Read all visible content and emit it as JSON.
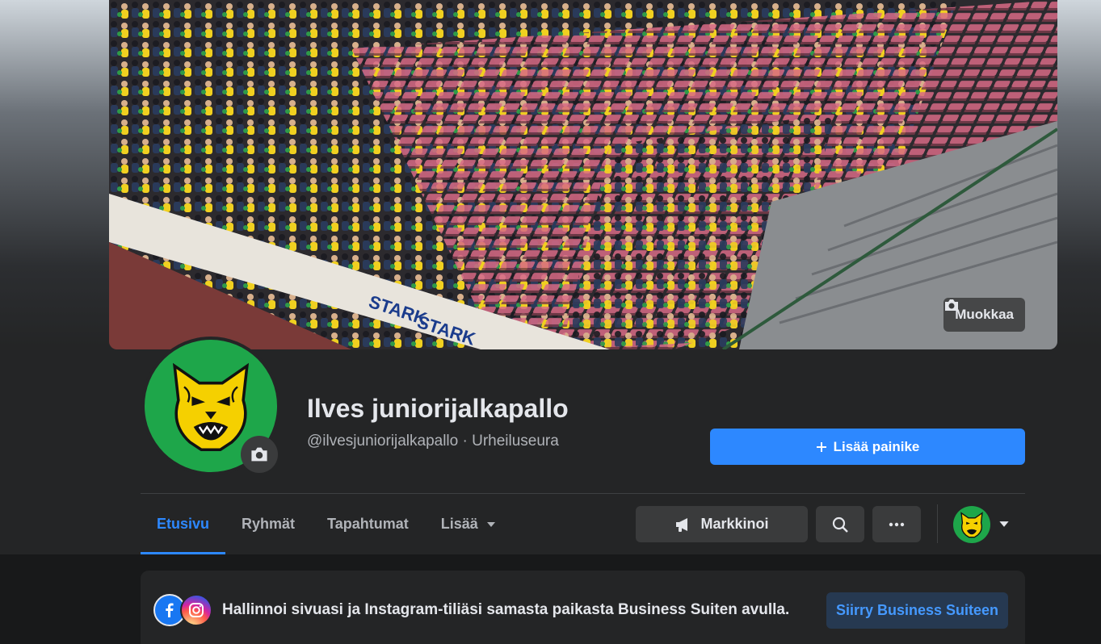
{
  "cover": {
    "edit_label": "Muokkaa"
  },
  "profile": {
    "name": "Ilves juniorijalkapallo",
    "subtitle": "@ilvesjuniorijalkapallo · Urheiluseura"
  },
  "actions": {
    "add_button_label": "Lisää painike",
    "promote_label": "Markkinoi"
  },
  "tabs": [
    {
      "label": "Etusivu",
      "active": true
    },
    {
      "label": "Ryhmät",
      "active": false
    },
    {
      "label": "Tapahtumat",
      "active": false
    },
    {
      "label": "Lisää",
      "active": false
    }
  ],
  "banner": {
    "text": "Hallinnoi sivuasi ja Instagram-tiliäsi samasta paikasta Business Suiten avulla.",
    "button_label": "Siirry Business Suiteen"
  },
  "icons": {
    "camera": "camera-icon",
    "plus": "plus-icon",
    "megaphone": "megaphone-icon",
    "search": "search-icon",
    "more": "more-icon",
    "dropdown": "caret-down-icon",
    "facebook": "facebook-icon",
    "instagram": "instagram-icon"
  },
  "colors": {
    "accent": "#2d88ff",
    "background": "#18191a",
    "surface": "#242526",
    "button": "#3a3b3c",
    "logo_green": "#1ea64a",
    "logo_yellow": "#f5d000"
  }
}
